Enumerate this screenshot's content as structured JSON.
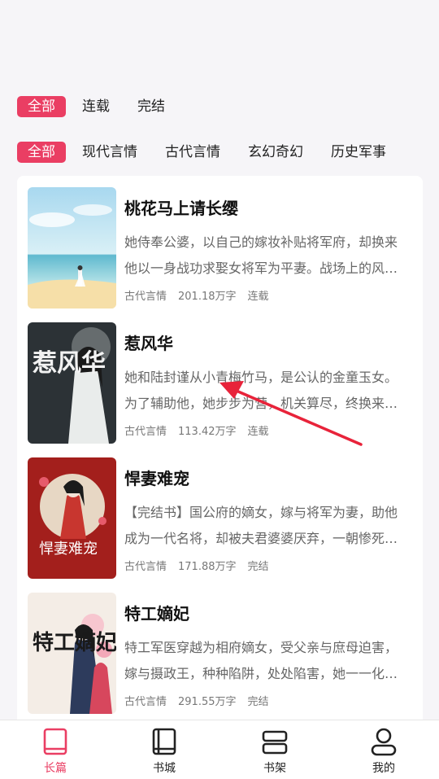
{
  "status_filters": [
    "全部",
    "连载",
    "完结"
  ],
  "genre_filters": [
    "全部",
    "现代言情",
    "古代言情",
    "玄幻奇幻",
    "历史军事"
  ],
  "books": [
    {
      "title": "桃花马上请长缨",
      "description": "她侍奉公婆，以自己的嫁妆补贴将军府，却换来他以一身战功求娶女将军为平妻。战场上的风光，他说她永远不懂。",
      "genre": "古代言情",
      "word_count": "201.18万字",
      "status": "连载"
    },
    {
      "title": "惹风华",
      "description": "她和陆封谨从小青梅竹马，是公认的金童玉女。为了辅助他，她步步为营，机关算尽，终换来一场背叛。",
      "genre": "古代言情",
      "word_count": "113.42万字",
      "status": "连载"
    },
    {
      "title": "悍妻难宠",
      "description": "【完结书】国公府的嫡女，嫁与将军为妻，助他成为一代名将，却被夫君婆婆厌弃，一朝惨死重生归来。",
      "genre": "古代言情",
      "word_count": "171.88万字",
      "status": "完结"
    },
    {
      "title": "特工嫡妃",
      "description": "特工军医穿越为相府嫡女，受父亲与庶母迫害，嫁与摄政王，种种陷阱，处处陷害，她一一化解。",
      "genre": "古代言情",
      "word_count": "291.55万字",
      "status": "完结"
    }
  ],
  "cover_texts": {
    "book2": "惹风华",
    "book3": "悍妻难宠",
    "book4": "特工嫡妃"
  },
  "tabs": [
    {
      "label": "长篇",
      "icon": "book-icon",
      "active": true
    },
    {
      "label": "书城",
      "icon": "bookstore-icon",
      "active": false
    },
    {
      "label": "书架",
      "icon": "bookshelf-icon",
      "active": false
    },
    {
      "label": "我的",
      "icon": "user-icon",
      "active": false
    }
  ],
  "colors": {
    "accent": "#ea3e63",
    "background": "#f6f5f8",
    "annotation_arrow": "#e8233a"
  }
}
